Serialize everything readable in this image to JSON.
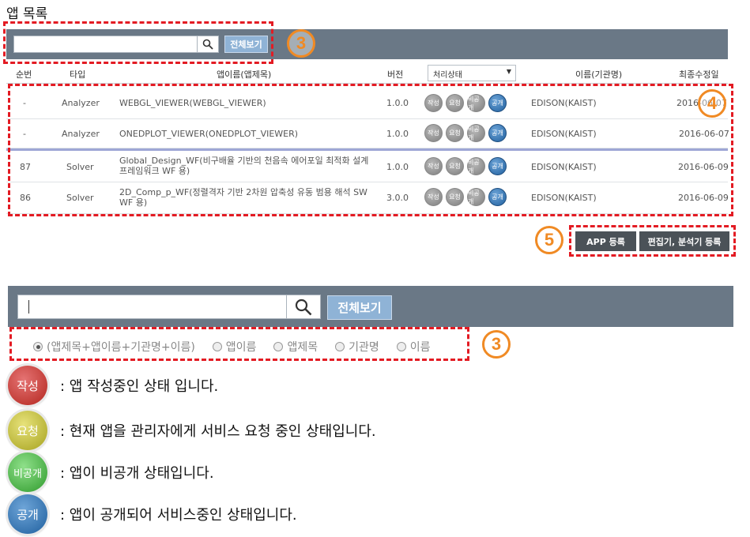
{
  "page_title": "앱 목록",
  "search": {
    "value": "",
    "view_all_label": "전체보기"
  },
  "callouts": {
    "n3": "3",
    "n4": "4",
    "n5": "5"
  },
  "table": {
    "headers": {
      "seq": "순번",
      "type": "타입",
      "app_name": "앱이름(앱제목)",
      "version": "버전",
      "status_select": "처리상태",
      "owner": "이름(기관명)",
      "modified": "최종수정일"
    },
    "badge_labels": [
      "작성",
      "요청",
      "비공개",
      "공개"
    ],
    "rows": [
      {
        "seq": "-",
        "type": "Analyzer",
        "name": "WEBGL_VIEWER(WEBGL_VIEWER)",
        "version": "1.0.0",
        "owner": "EDISON(KAIST)",
        "date": "2016-06-07"
      },
      {
        "seq": "-",
        "type": "Analyzer",
        "name": "ONEDPLOT_VIEWER(ONEDPLOT_VIEWER)",
        "version": "1.0.0",
        "owner": "EDISON(KAIST)",
        "date": "2016-06-07"
      },
      {
        "seq": "87",
        "type": "Solver",
        "name": "Global_Design_WF(비구배율 기반의 천음속 에어포일 최적화 설계 프레임워크 WF 용)",
        "version": "1.0.0",
        "owner": "EDISON(KAIST)",
        "date": "2016-06-09"
      },
      {
        "seq": "86",
        "type": "Solver",
        "name": "2D_Comp_p_WF(정렬격자 기반 2차원 압축성 유동 범용 해석 SW WF 용)",
        "version": "3.0.0",
        "owner": "EDISON(KAIST)",
        "date": "2016-06-09"
      }
    ]
  },
  "buttons": {
    "app_register": "APP 등록",
    "editor_register": "편집기, 분석기 등록"
  },
  "zoom": {
    "search_value": "",
    "view_all_label": "전체보기",
    "radio_options": [
      "(앱제목+앱이름+기관명+이름)",
      "앱이름",
      "앱제목",
      "기관명",
      "이름"
    ],
    "selected_index": 0
  },
  "legend": [
    {
      "badge": "작성",
      "text": ": 앱 작성중인 상태 입니다.",
      "color": "#c0392b"
    },
    {
      "badge": "요청",
      "text": ": 현재 앱을 관리자에게 서비스 요청 중인 상태입니다.",
      "color": "#bdb832"
    },
    {
      "badge": "비공개",
      "text": ": 앱이 비공개 상태입니다.",
      "color": "#3fae3c"
    },
    {
      "badge": "공개",
      "text": ": 앱이 공개되어 서비스중인 상태입니다.",
      "color": "#2a6cad"
    }
  ]
}
